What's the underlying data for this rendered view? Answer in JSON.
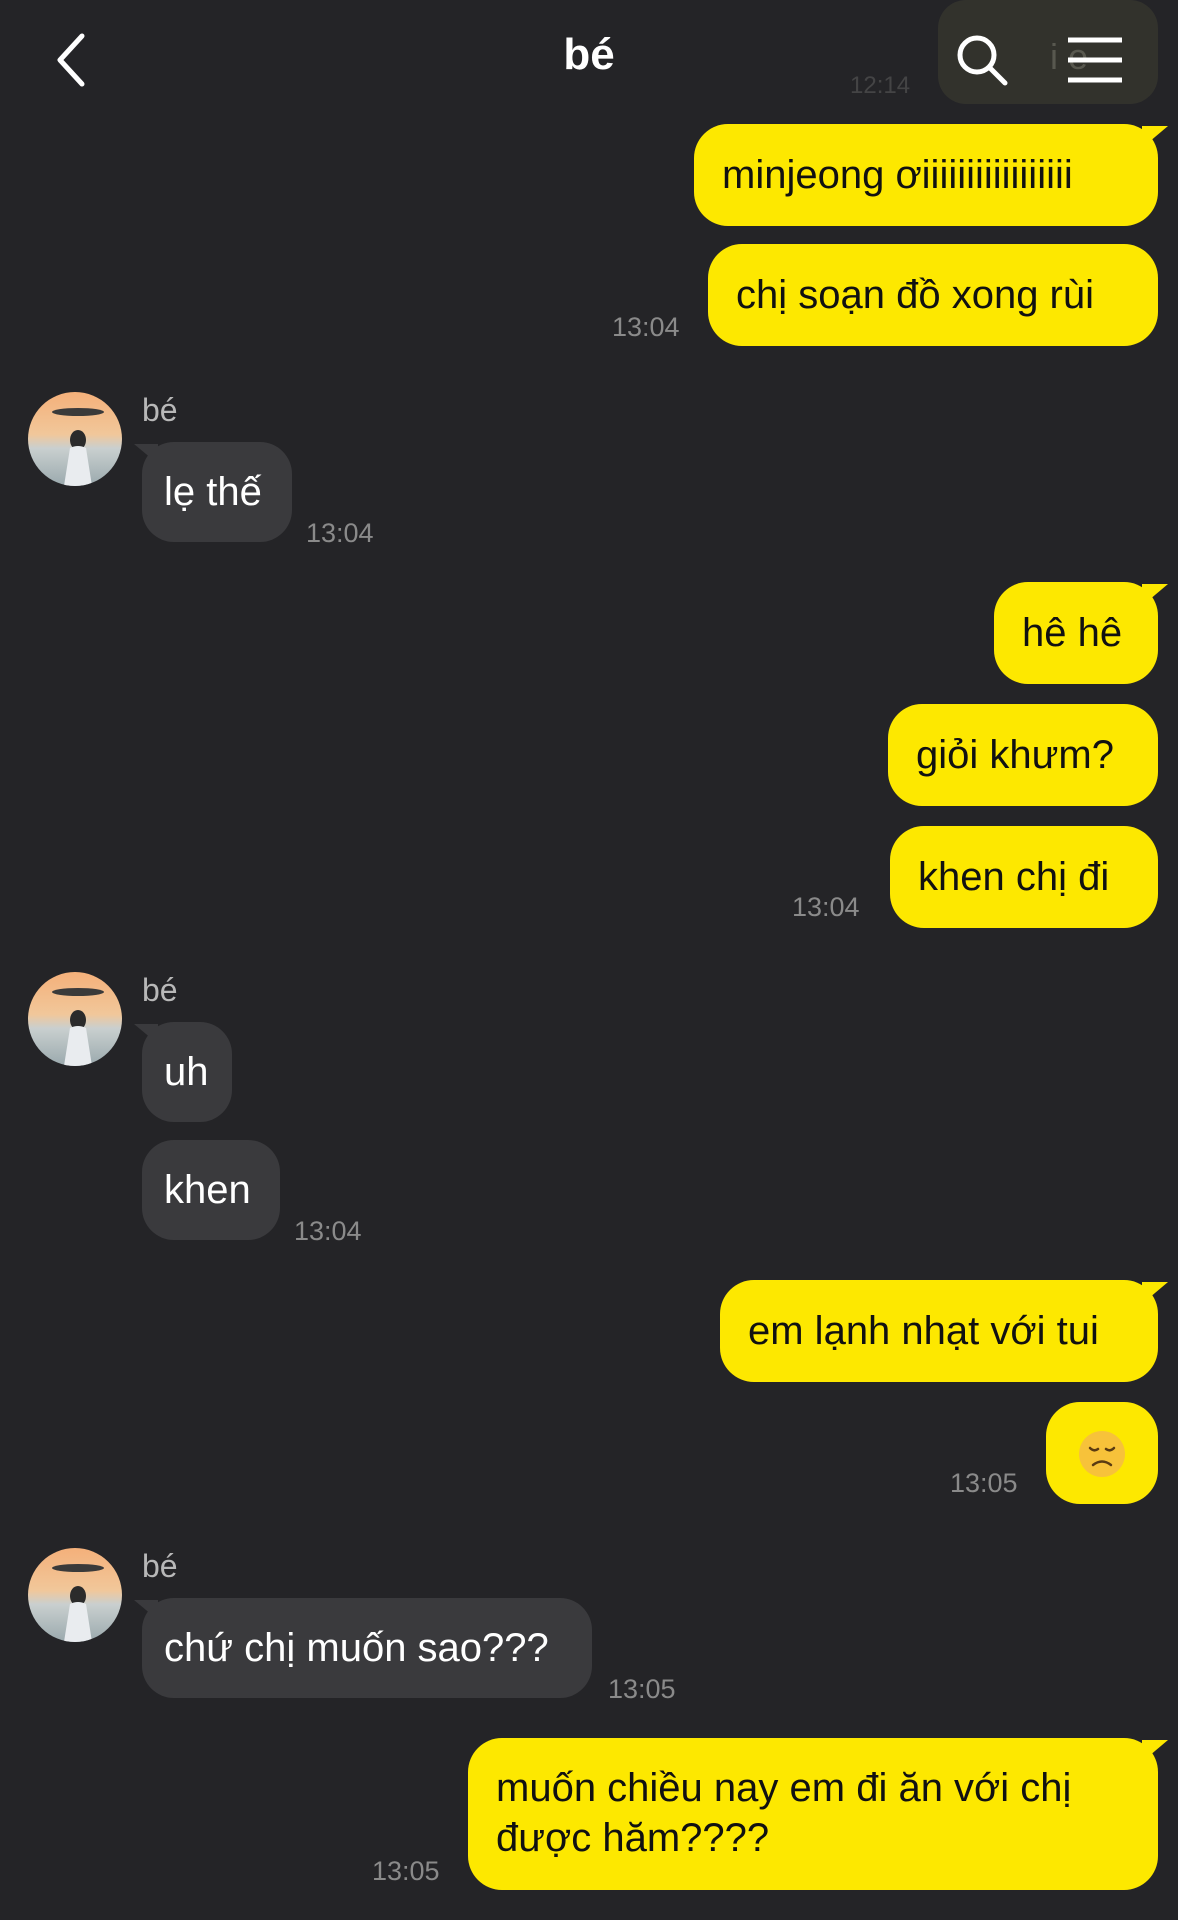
{
  "header": {
    "title": "bé"
  },
  "ghost": {
    "text": "i e",
    "time": "12:14"
  },
  "messages": [
    {
      "dir": "out",
      "text": "minjeong ơiiiiiiiiiiiiiiiii"
    },
    {
      "dir": "out",
      "text": "chị soạn đồ xong rùi",
      "time": "13:04"
    },
    {
      "dir": "in",
      "sender": "bé",
      "text": "lẹ thế",
      "time": "13:04"
    },
    {
      "dir": "out",
      "text": "hê hê"
    },
    {
      "dir": "out",
      "text": "giỏi khưm?"
    },
    {
      "dir": "out",
      "text": "khen chị đi",
      "time": "13:04"
    },
    {
      "dir": "in",
      "sender": "bé",
      "text": "uh"
    },
    {
      "dir": "in",
      "text": "khen",
      "time": "13:04"
    },
    {
      "dir": "out",
      "text": "em lạnh nhạt với tui"
    },
    {
      "dir": "out",
      "emoji": "disappointed-face",
      "time": "13:05"
    },
    {
      "dir": "in",
      "sender": "bé",
      "text": "chứ chị muốn sao???",
      "time": "13:05"
    },
    {
      "dir": "out",
      "text": "muốn chiều nay em đi ăn với chị được hăm????",
      "line1": "muốn chiều nay em đi ăn với chị",
      "line2": "được hăm????",
      "time": "13:05"
    }
  ],
  "colors": {
    "background": "#242427",
    "outgoing": "#fde800",
    "incoming": "#3a3a3d",
    "timestamp": "#8a8a8a"
  }
}
